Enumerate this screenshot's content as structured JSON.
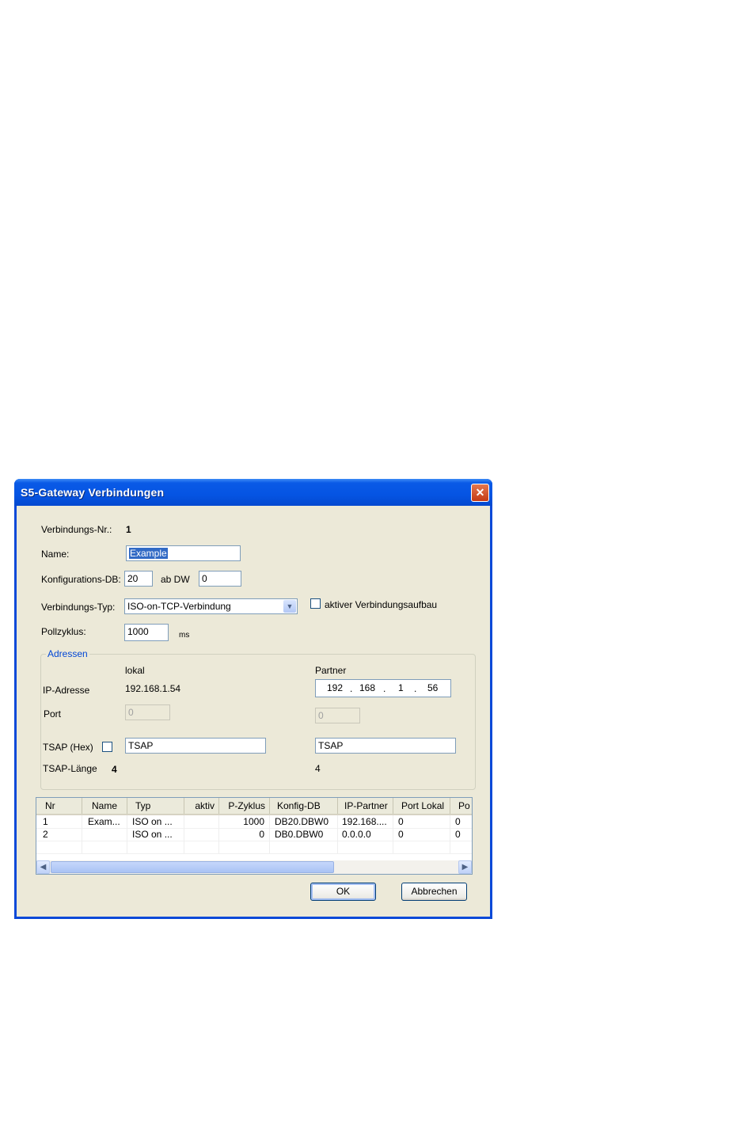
{
  "window": {
    "title": "S5-Gateway Verbindungen",
    "close_label": "✕"
  },
  "form": {
    "conn_nr_label": "Verbindungs-Nr.:",
    "conn_nr_value": "1",
    "name_label": "Name:",
    "name_value": "Example",
    "config_db_label": "Konfigurations-DB:",
    "config_db_value": "20",
    "ab_dw_label": "ab DW",
    "ab_dw_value": "0",
    "conn_type_label": "Verbindungs-Typ:",
    "conn_type_value": "ISO-on-TCP-Verbindung",
    "active_conn_label": "aktiver Verbindungsaufbau",
    "active_conn_checked": false,
    "poll_label": "Pollzyklus:",
    "poll_value": "1000",
    "poll_unit": "ms"
  },
  "addresses": {
    "group_title": "Adressen",
    "local_header": "lokal",
    "partner_header": "Partner",
    "ip_label": "IP-Adresse",
    "local_ip": "192.168.1.54",
    "partner_ip": [
      "192",
      "168",
      "1",
      "56"
    ],
    "port_label": "Port",
    "local_port": "0",
    "partner_port": "0",
    "tsap_label": "TSAP (Hex)",
    "tsap_hex_checked": false,
    "local_tsap": "TSAP",
    "partner_tsap": "TSAP",
    "tsap_len_label": "TSAP-Länge",
    "local_tsap_len": "4",
    "partner_tsap_len": "4"
  },
  "table": {
    "columns": [
      "Nr",
      "Name",
      "Typ",
      "aktiv",
      "P-Zyklus",
      "Konfig-DB",
      "IP-Partner",
      "Port Lokal",
      "Po"
    ],
    "rows": [
      [
        "1",
        "Exam...",
        "ISO on ...",
        "",
        "1000",
        "DB20.DBW0",
        "192.168....",
        "0",
        "0"
      ],
      [
        "2",
        "",
        "ISO on ...",
        "",
        "0",
        "DB0.DBW0",
        "0.0.0.0",
        "0",
        "0"
      ]
    ]
  },
  "buttons": {
    "ok": "OK",
    "cancel": "Abbrechen"
  },
  "colors": {
    "titlebar": "#0554e3",
    "client": "#ece9d8",
    "group_title": "#0046d5",
    "selection": "#316ac5"
  }
}
